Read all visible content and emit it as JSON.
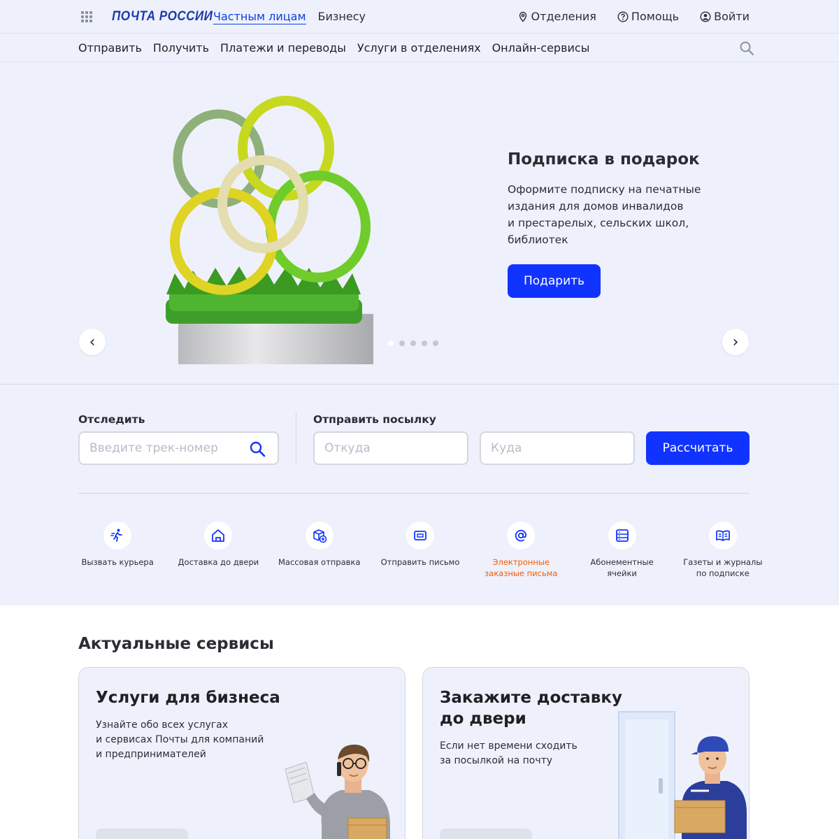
{
  "header": {
    "logo": "ПОЧТА РОССИИ",
    "nav": [
      {
        "label": "Частным лицам",
        "active": true
      },
      {
        "label": "Бизнесу",
        "active": false
      }
    ],
    "right": {
      "offices": "Отделения",
      "help": "Помощь",
      "login": "Войти"
    }
  },
  "subnav": {
    "items": [
      "Отправить",
      "Получить",
      "Платежи и переводы",
      "Услуги в отделениях",
      "Онлайн-сервисы"
    ]
  },
  "hero": {
    "title": "Подписка в подарок",
    "text_lines": [
      "Оформите подписку на печатные",
      "издания для домов инвалидов",
      "и престарелых, сельских школ,",
      "библиотек"
    ],
    "button": "Подарить",
    "prev": "‹",
    "next": "›",
    "slides_total": 5,
    "slide_active": 1
  },
  "tracking": {
    "label": "Отследить",
    "placeholder": "Введите трек-номер"
  },
  "parcel": {
    "label": "Отправить посылку",
    "from_placeholder": "Откуда",
    "to_placeholder": "Куда",
    "button": "Рассчитать"
  },
  "services": [
    {
      "icon": "courier-icon",
      "lines": [
        "Вызвать курьера"
      ]
    },
    {
      "icon": "home-icon",
      "lines": [
        "Доставка до двери"
      ]
    },
    {
      "icon": "box-plus-icon",
      "lines": [
        "Массовая отправка"
      ]
    },
    {
      "icon": "letter-icon",
      "lines": [
        "Отправить письмо"
      ]
    },
    {
      "icon": "at-icon",
      "lines": [
        "Электронные",
        "заказные письма"
      ],
      "highlight": true
    },
    {
      "icon": "lockers-icon",
      "lines": [
        "Абонементные",
        "ячейки"
      ]
    },
    {
      "icon": "newspaper-icon",
      "lines": [
        "Газеты и журналы",
        "по подписке"
      ]
    }
  ],
  "actual": {
    "title": "Актуальные сервисы",
    "cards": [
      {
        "title_lines": [
          "Услуги для бизнеса"
        ],
        "text_lines": [
          "Узнайте обо всех услугах",
          "и сервисах Почты для компаний",
          "и предпринимателей"
        ]
      },
      {
        "title_lines": [
          "Закажите доставку",
          "до двери"
        ],
        "text_lines": [
          "Если нет времени сходить",
          "за посылкой на почту"
        ]
      }
    ]
  },
  "colors": {
    "brand_blue": "#1133ff",
    "logo_blue": "#1c3aa9",
    "highlight_orange": "#f25c05",
    "background": "#eef1fb"
  }
}
